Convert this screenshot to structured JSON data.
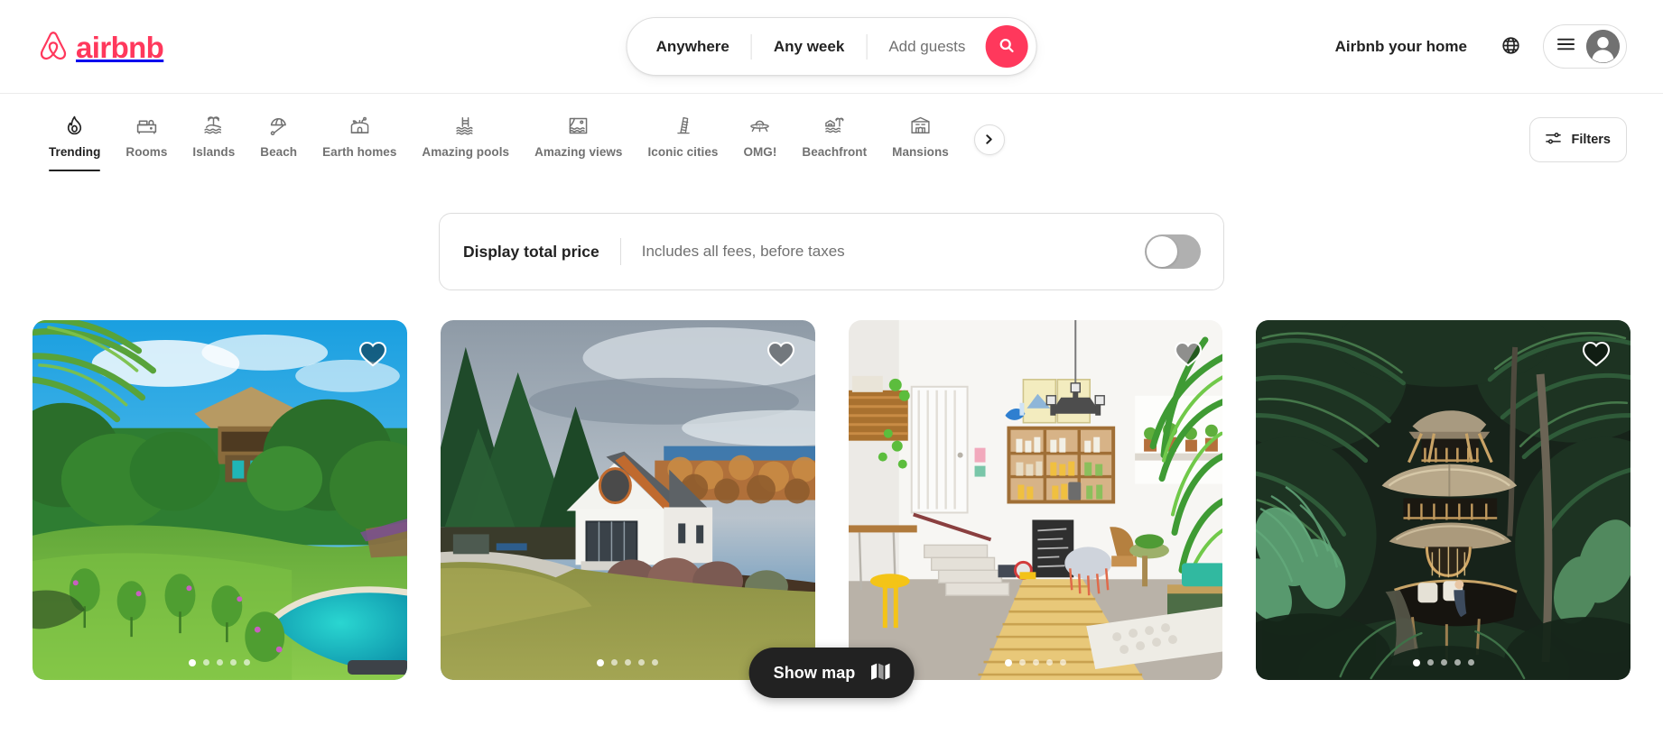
{
  "brand": {
    "name": "airbnb",
    "color": "#FF385C",
    "logo_icon": "airbnb-belo-logo"
  },
  "search": {
    "location": "Anywhere",
    "dates": "Any week",
    "guests_placeholder": "Add guests",
    "search_icon": "search-icon"
  },
  "header": {
    "host_link": "Airbnb your home",
    "globe_icon": "globe-icon",
    "menu_icon": "hamburger-menu-icon",
    "avatar_icon": "user-avatar-icon"
  },
  "categories": [
    {
      "label": "Trending",
      "icon": "flame-icon",
      "active": true
    },
    {
      "label": "Rooms",
      "icon": "bed-room-icon",
      "active": false
    },
    {
      "label": "Islands",
      "icon": "island-palm-icon",
      "active": false
    },
    {
      "label": "Beach",
      "icon": "beach-umbrella-icon",
      "active": false
    },
    {
      "label": "Earth homes",
      "icon": "earth-home-icon",
      "active": false
    },
    {
      "label": "Amazing pools",
      "icon": "pool-icon",
      "active": false
    },
    {
      "label": "Amazing views",
      "icon": "landscape-view-icon",
      "active": false
    },
    {
      "label": "Iconic cities",
      "icon": "leaning-tower-icon",
      "active": false
    },
    {
      "label": "OMG!",
      "icon": "ufo-icon",
      "active": false
    },
    {
      "label": "Beachfront",
      "icon": "beachfront-icon",
      "active": false
    },
    {
      "label": "Mansions",
      "icon": "mansion-icon",
      "active": false
    }
  ],
  "nav_controls": {
    "next_icon": "chevron-right-icon",
    "filters_label": "Filters",
    "filters_icon": "sliders-icon"
  },
  "price_panel": {
    "title": "Display total price",
    "subtitle": "Includes all fees, before taxes",
    "toggle_state": "off"
  },
  "map_button": {
    "label": "Show map",
    "icon": "folded-map-icon"
  },
  "listings": [
    {
      "photo_alt": "Tropical thatched-roof villa in lush green garden with turquoise pool",
      "favorite_icon": "heart-icon",
      "favorited": false,
      "carousel_dots": 5,
      "carousel_active": 1
    },
    {
      "photo_alt": "Modern white barn house on hillside with autumn foliage and evergreens",
      "favorite_icon": "heart-icon",
      "favorited": false,
      "carousel_dots": 5,
      "carousel_active": 1
    },
    {
      "photo_alt": "Bright bohemian interior with plants, wooden shelves and bamboo walkway",
      "favorite_icon": "heart-icon",
      "favorited": false,
      "carousel_dots": 5,
      "carousel_active": 1
    },
    {
      "photo_alt": "Multi-level bamboo treehouse nestled in dark tropical jungle canopy",
      "favorite_icon": "heart-icon",
      "favorited": false,
      "carousel_dots": 5,
      "carousel_active": 1
    }
  ]
}
